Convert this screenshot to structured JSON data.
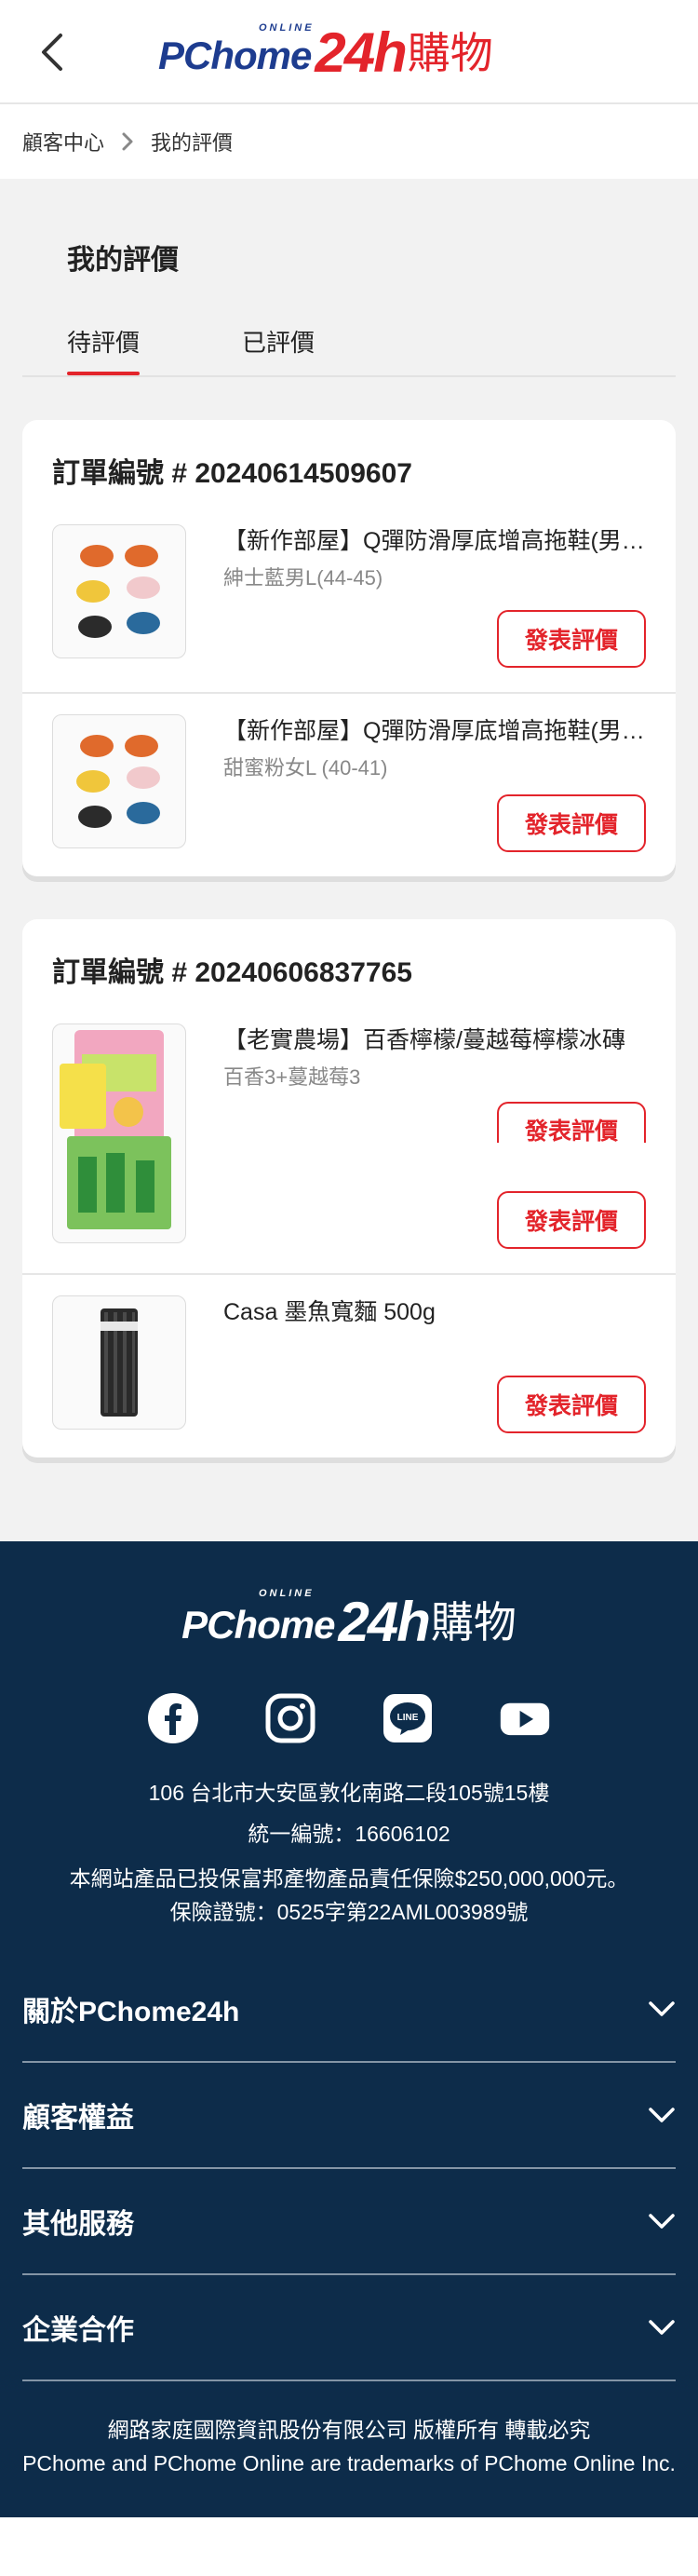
{
  "header": {
    "logo_text_main": "PChome",
    "logo_text_online": "ONLINE",
    "logo_text_24h": "24h",
    "logo_text_shop": "購物"
  },
  "breadcrumb": {
    "items": [
      "顧客中心",
      "我的評價"
    ]
  },
  "page": {
    "title": "我的評價",
    "tabs": [
      {
        "label": "待評價",
        "active": true
      },
      {
        "label": "已評價",
        "active": false
      }
    ]
  },
  "orders": [
    {
      "order_label": "訂單編號 # 20240614509607",
      "items": [
        {
          "name": "【新作部屋】Q彈防滑厚底增高拖鞋(男女款)",
          "spec": "紳士藍男L(44-45)",
          "button": "發表評價"
        },
        {
          "name": "【新作部屋】Q彈防滑厚底增高拖鞋(男女款)",
          "spec": "甜蜜粉女L (40-41)",
          "button": "發表評價"
        }
      ]
    },
    {
      "order_label": "訂單編號 # 20240606837765",
      "items": [
        {
          "name": "【老實農場】百香檸檬/蔓越莓檸檬冰磚",
          "spec": "百香3+蔓越莓3",
          "button": "發表評價",
          "ghost_button": "發表評價"
        },
        {
          "name": "Casa 墨魚寬麵 500g",
          "spec": "",
          "button": "發表評價"
        }
      ]
    }
  ],
  "footer": {
    "address": "106 台北市大安區敦化南路二段105號15樓",
    "tax_id": "統一編號：16606102",
    "insurance_line1": "本網站產品已投保富邦產物產品責任保險$250,000,000元。",
    "insurance_line2": "保險證號：0525字第22AML003989號",
    "accordion": [
      "關於PChome24h",
      "顧客權益",
      "其他服務",
      "企業合作"
    ],
    "copyright_line1": "網路家庭國際資訊股份有限公司 版權所有 轉載必究",
    "copyright_line2": "PChome and PChome Online are trademarks of PChome Online Inc."
  },
  "icons": {
    "back": "chevron-left-icon",
    "breadcrumb_separator": "chevron-right-icon",
    "social": [
      "facebook-icon",
      "instagram-icon",
      "line-icon",
      "youtube-icon"
    ],
    "accordion": "chevron-down-icon"
  },
  "colors": {
    "accent_red": "#e3242b",
    "brand_blue": "#1d3c8f",
    "footer_bg": "#0d2c4a",
    "page_bg": "#f2f2f2"
  }
}
